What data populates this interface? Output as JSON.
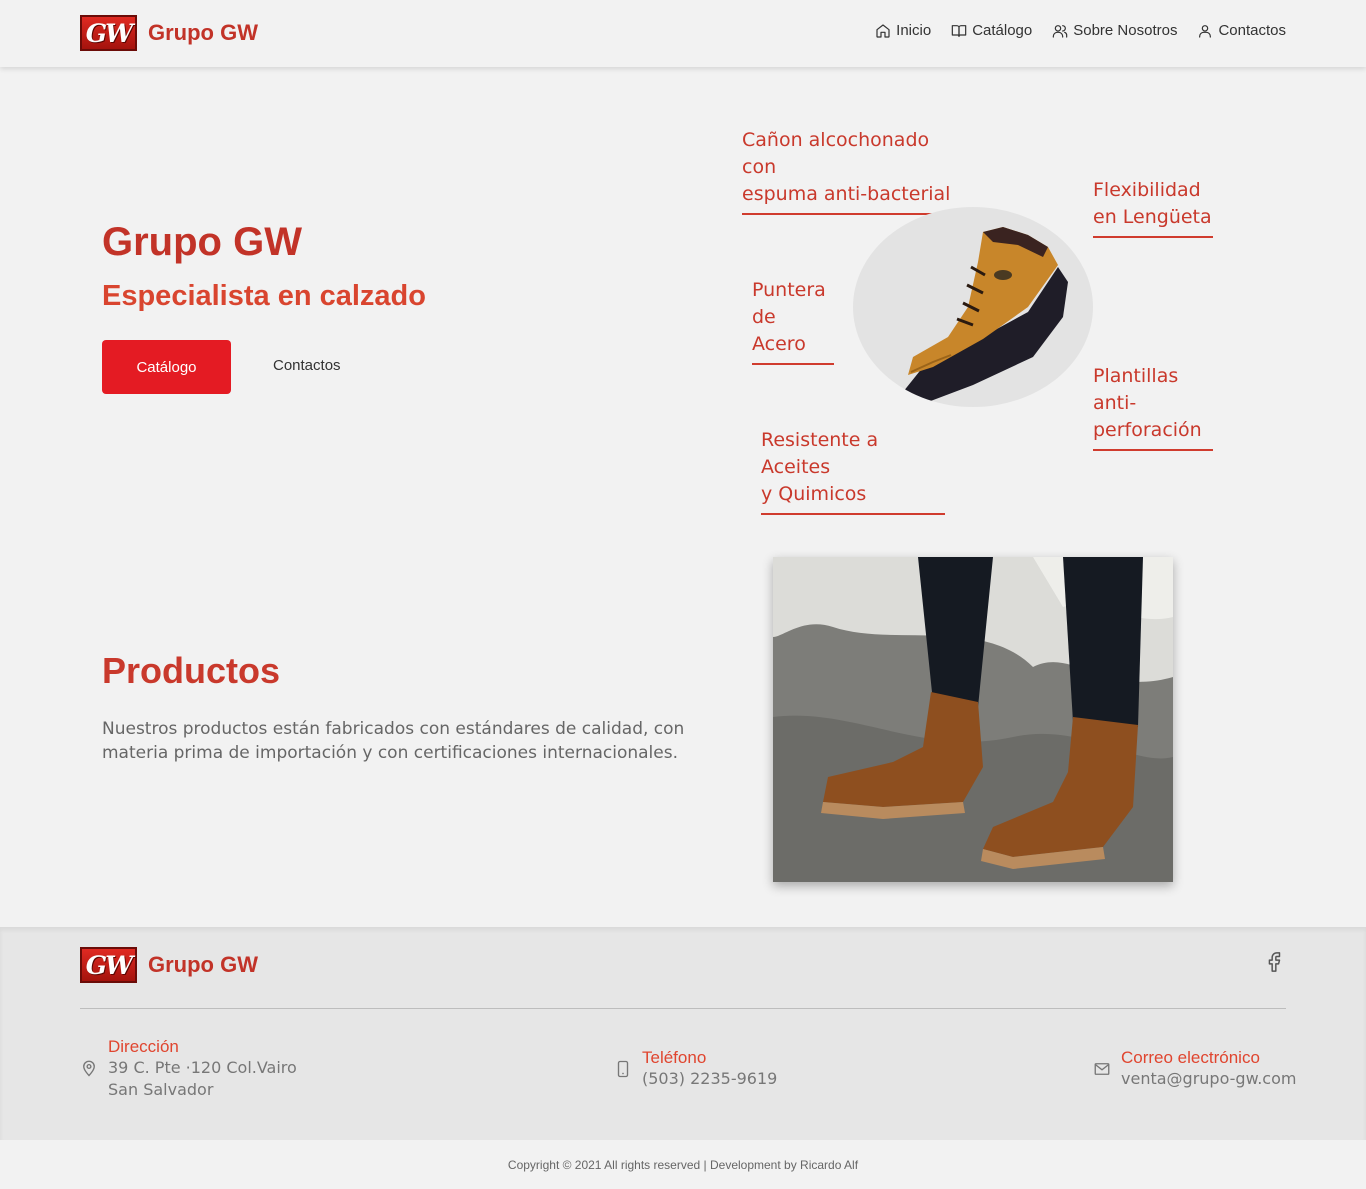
{
  "brand": {
    "logo_mark": "GW",
    "name": "Grupo GW"
  },
  "nav": [
    {
      "label": "Inicio",
      "icon": "home-icon"
    },
    {
      "label": "Catálogo",
      "icon": "book-icon"
    },
    {
      "label": "Sobre Nosotros",
      "icon": "users-icon"
    },
    {
      "label": "Contactos",
      "icon": "user-icon"
    }
  ],
  "hero": {
    "title": "Grupo GW",
    "subtitle": "Especialista en calzado",
    "primary_button": "Catálogo",
    "secondary_link": "Contactos"
  },
  "features": {
    "canon": [
      "Cañon alcochonado con",
      "espuma anti-bacterial"
    ],
    "flex": [
      "Flexibilidad",
      "en Lengüeta"
    ],
    "puntera": [
      "Puntera",
      "de Acero"
    ],
    "plantillas": [
      "Plantillas",
      "anti-",
      "perforación"
    ],
    "aceites": [
      "Resistente a Aceites",
      "y Quimicos"
    ]
  },
  "productos": {
    "title": "Productos",
    "text": "Nuestros productos están fabricados con estándares de calidad, con materia prima de importación y con certificaciones internacionales."
  },
  "footer": {
    "address": {
      "label": "Dirección",
      "lines": [
        "39 C. Pte ·120 Col.Vairo",
        "San Salvador"
      ]
    },
    "phone": {
      "label": "Teléfono",
      "value": "(503) 2235-9619"
    },
    "email": {
      "label": "Correo electrónico",
      "value": "venta@grupo-gw.com"
    },
    "copyright": "Copyright © 2021 All rights reserved | Development by Ricardo Alf"
  },
  "colors": {
    "brand_red": "#c23328",
    "button_red": "#e41b23",
    "accent": "#e0452f"
  }
}
